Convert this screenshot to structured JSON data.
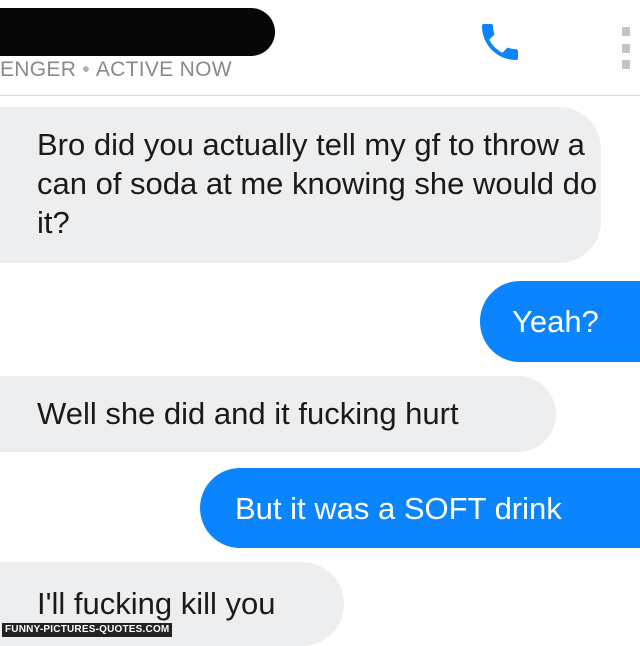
{
  "header": {
    "status_name": "ENGER",
    "status_separator": "•",
    "status_text": "ACTIVE NOW",
    "call_icon": "phone-icon",
    "menu_icon": "more-vertical-icon",
    "accent_color": "#0a84ff"
  },
  "messages": [
    {
      "direction": "incoming",
      "text": "Bro did you actually tell my gf to throw a can of soda at me knowing she would do it?"
    },
    {
      "direction": "outgoing",
      "text": "Yeah?"
    },
    {
      "direction": "incoming",
      "text": "Well she did and it fucking hurt"
    },
    {
      "direction": "outgoing",
      "text": "But it was a SOFT drink"
    },
    {
      "direction": "incoming",
      "text": "I'll fucking kill you"
    }
  ],
  "watermark": "FUNNY-PICTURES-QUOTES.COM",
  "colors": {
    "incoming_bubble": "#eceef0",
    "outgoing_bubble": "#0a84ff"
  }
}
